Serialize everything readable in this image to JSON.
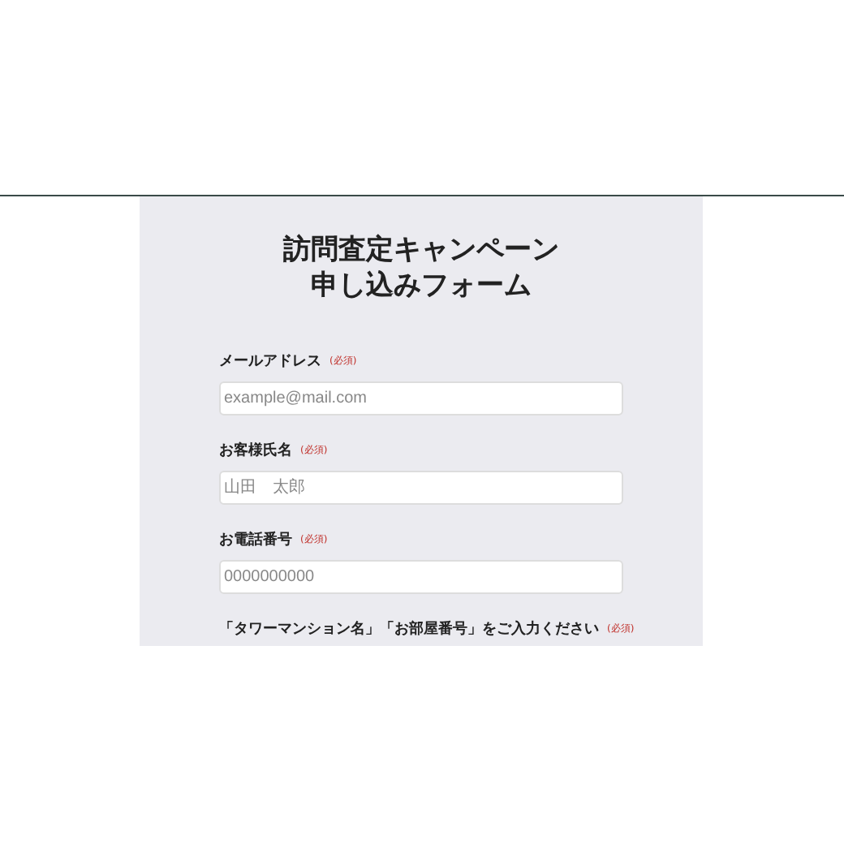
{
  "form": {
    "title_lines": [
      "訪問査定キャンペーン",
      "申し込みフォーム"
    ],
    "fields": [
      {
        "label": "メールアドレス",
        "required_mark": "(必須)",
        "placeholder": "example@mail.com"
      },
      {
        "label": "お客様氏名",
        "required_mark": "(必須)",
        "placeholder": "山田　太郎"
      },
      {
        "label": "お電話番号",
        "required_mark": "(必須)",
        "placeholder": "0000000000"
      },
      {
        "label": "「タワーマンション名」「お部屋番号」をご入力ください",
        "required_mark": "(必須)"
      }
    ]
  }
}
